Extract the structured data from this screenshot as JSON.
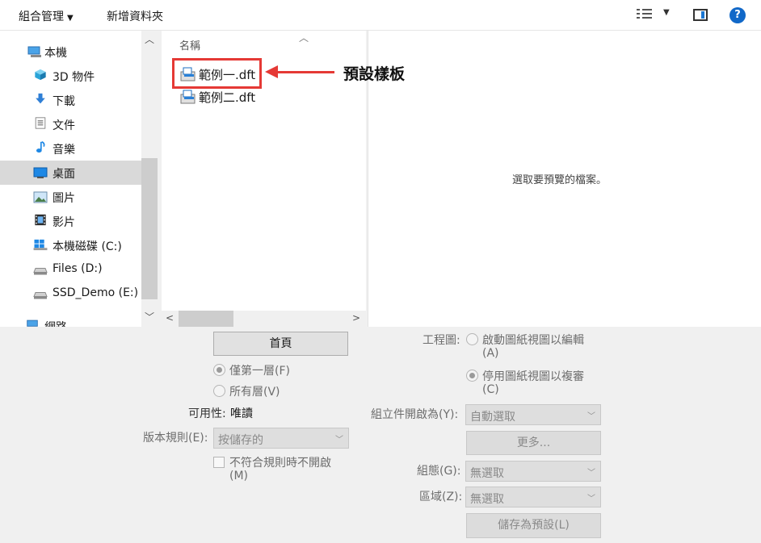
{
  "toolbar": {
    "organize_label": "組合管理",
    "new_folder_label": "新增資料夾"
  },
  "nav": {
    "items": [
      {
        "label": "本機",
        "icon": "computer-icon"
      },
      {
        "label": "3D 物件",
        "icon": "cube-icon"
      },
      {
        "label": "下載",
        "icon": "download-icon"
      },
      {
        "label": "文件",
        "icon": "document-icon"
      },
      {
        "label": "音樂",
        "icon": "music-icon"
      },
      {
        "label": "桌面",
        "icon": "desktop-icon",
        "selected": true
      },
      {
        "label": "圖片",
        "icon": "picture-icon"
      },
      {
        "label": "影片",
        "icon": "video-icon"
      },
      {
        "label": "本機磁碟 (C:)",
        "icon": "windows-drive-icon"
      },
      {
        "label": "Files (D:)",
        "icon": "drive-icon"
      },
      {
        "label": "SSD_Demo (E:)",
        "icon": "drive-icon"
      },
      {
        "label": "網路",
        "icon": "network-icon"
      }
    ]
  },
  "files": {
    "column_name": "名稱",
    "items": [
      {
        "name": "範例一.dft"
      },
      {
        "name": "範例二.dft"
      }
    ]
  },
  "preview": {
    "message": "選取要預覽的檔案。"
  },
  "annotation": {
    "label": "預設樣板"
  },
  "options": {
    "home_button": "首頁",
    "first_level": "僅第一層(F)",
    "all_levels": "所有層(V)",
    "availability_label": "可用性:",
    "availability_value": "唯讀",
    "revision_rule_label": "版本規則(E):",
    "revision_rule_value": "按儲存的",
    "no_open_label": "不符合規則時不開啟",
    "no_open_key": "(M)",
    "drawing_label": "工程圖:",
    "enable_view": "啟動圖紙視圖以編輯",
    "enable_view_key": "(A)",
    "disable_view": "停用圖紙視圖以複審",
    "disable_view_key": "(C)",
    "assembly_open_label": "組立件開啟為(Y):",
    "assembly_open_value": "自動選取",
    "more_button": "更多...",
    "config_label": "組態(G):",
    "config_value": "無選取",
    "zone_label": "區域(Z):",
    "zone_value": "無選取",
    "save_default_button": "儲存為預設(L)"
  }
}
